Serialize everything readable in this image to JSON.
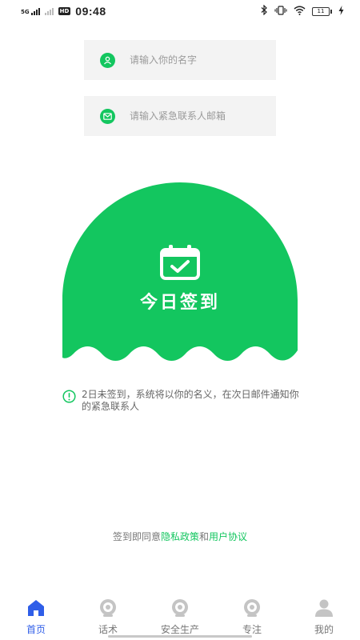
{
  "status_bar": {
    "network_label": "5G",
    "time": "09:48",
    "hd_label": "HD",
    "battery_level": "11",
    "icons": [
      "signal-icon",
      "hd-icon",
      "bluetooth-icon",
      "vibrate-icon",
      "wifi-icon",
      "battery-icon",
      "charging-icon"
    ]
  },
  "form": {
    "name_placeholder": "请输入你的名字",
    "email_placeholder": "请输入紧急联系人邮箱",
    "name_icon": "user-icon",
    "email_icon": "mail-icon"
  },
  "checkin": {
    "label": "今日签到",
    "icon": "calendar-check-icon",
    "color": "#13c65f"
  },
  "notice": {
    "icon": "info-icon",
    "text": "2日未签到，系统将以你的名义，在次日邮件通知你的紧急联系人"
  },
  "agreement": {
    "prefix": "签到即同意",
    "privacy_link": "隐私政策",
    "conjunction": "和",
    "terms_link": "用户协议"
  },
  "tabbar": {
    "active_color": "#2f5ee8",
    "inactive_color": "#c4c4c4",
    "items": [
      {
        "label": "首页",
        "icon": "home-icon",
        "active": true
      },
      {
        "label": "话术",
        "icon": "mascot-icon",
        "active": false
      },
      {
        "label": "安全生产",
        "icon": "mascot-icon",
        "active": false
      },
      {
        "label": "专注",
        "icon": "mascot-icon",
        "active": false
      },
      {
        "label": "我的",
        "icon": "person-icon",
        "active": false
      }
    ]
  }
}
